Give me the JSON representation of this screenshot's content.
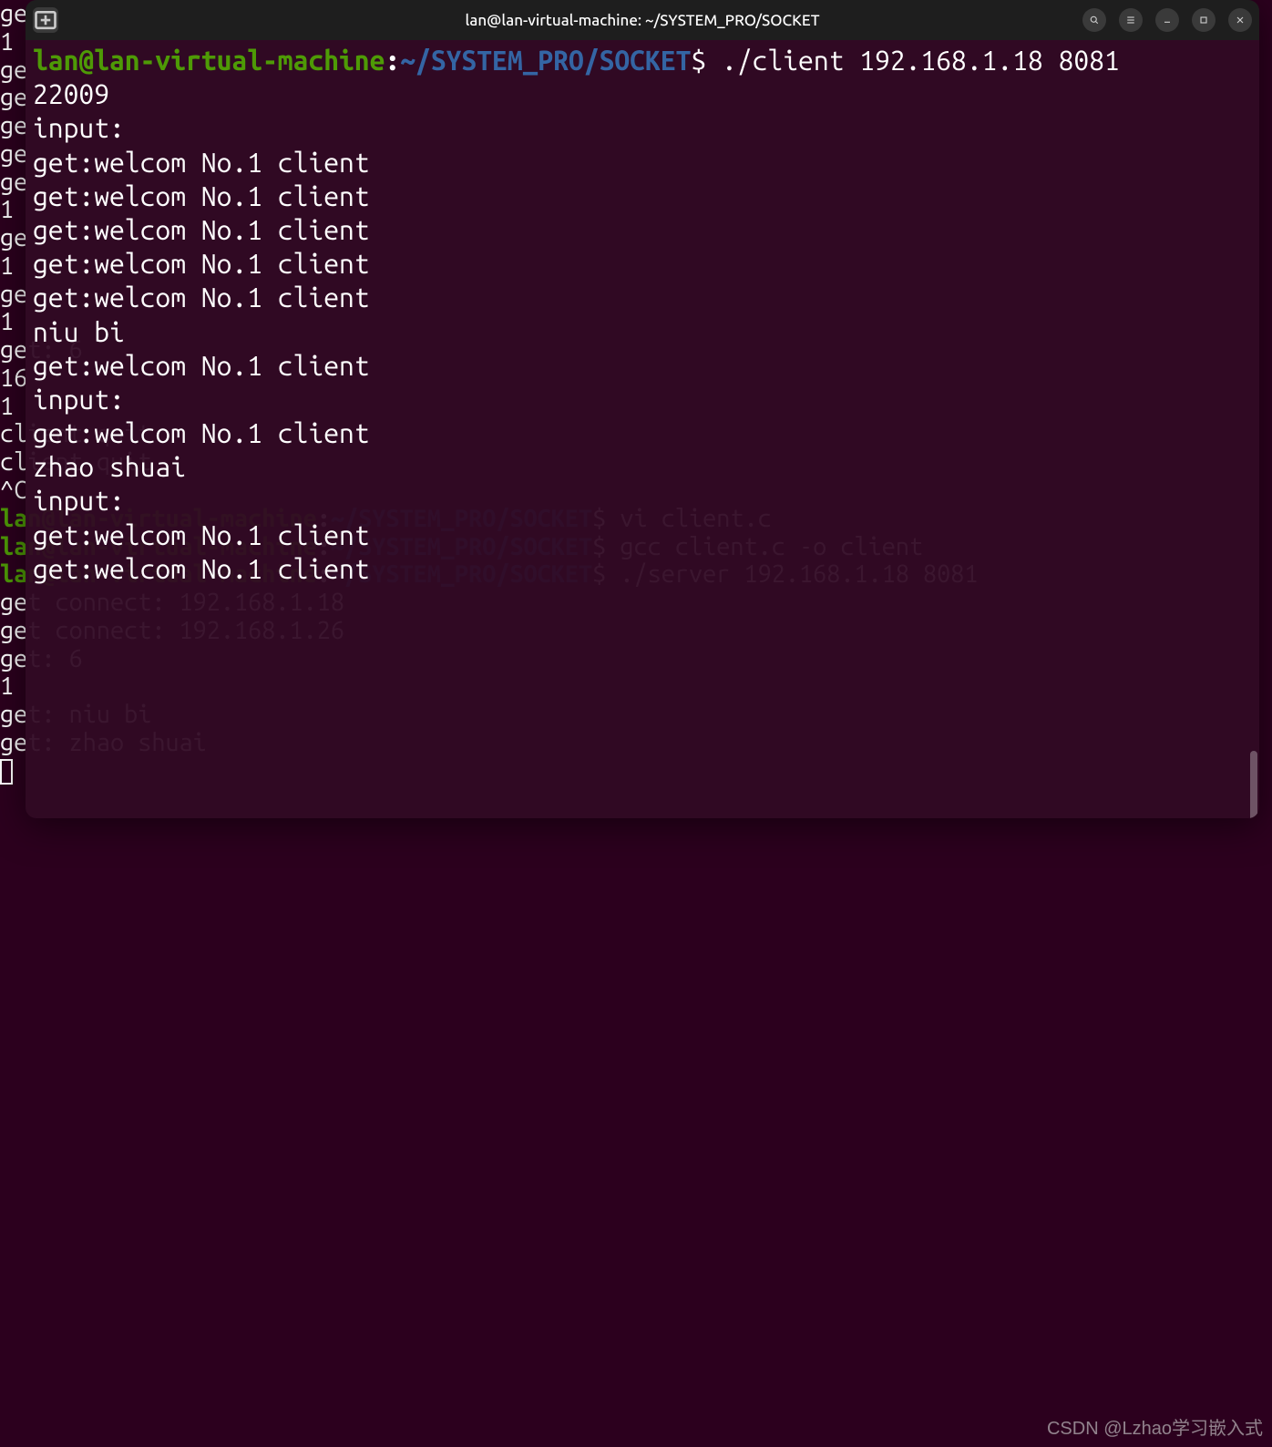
{
  "window": {
    "title": "lan@lan-virtual-machine: ~/SYSTEM_PRO/SOCKET"
  },
  "prompt": {
    "user": "lan@lan-virtual-machine",
    "path": "~/SYSTEM_PRO/SOCKET",
    "symbol": "$"
  },
  "fg_lines": {
    "cmd1": " ./client 192.168.1.18 8081",
    "l2": "22009",
    "l3": "input:",
    "l4": "get:welcom No.1 client",
    "l5": "",
    "l6": "get:welcom No.1 client",
    "l7": "",
    "l8": "get:welcom No.1 client",
    "l9": "",
    "l10": "get:welcom No.1 client",
    "l11": "",
    "l12": "get:welcom No.1 client",
    "l13": "niu bi",
    "l14": "get:welcom No.1 client",
    "l15": "",
    "l16": "input:",
    "l17": "get:welcom No.1 client",
    "l18": "zhao shuai",
    "l19": "input:",
    "l20": "get:welcom No.1 client",
    "l21": "",
    "l22": "get:welcom No.1 client"
  },
  "bg_left": {
    "b0": "ge",
    "b1": "1",
    "b2": "",
    "b3": "",
    "b4": "",
    "b5": "ge",
    "b6": "",
    "b7": "",
    "b8": "ge",
    "b9": "",
    "b10": "",
    "b11": "ge",
    "b12": "",
    "b13": "",
    "b14": "ge",
    "b15": "",
    "b16": "ge",
    "b17": "1",
    "b18": "",
    "b19": "",
    "b20": "ge",
    "b21": "1",
    "b22": "",
    "b23": "ge",
    "b24": "1"
  },
  "bg_lines": {
    "g1": "",
    "g2": "get: 6",
    "g3": "16",
    "g4": "1",
    "g5": "client quit",
    "g6": "client quit",
    "g7": "^C",
    "cmd_vi": " vi client.c",
    "cmd_gcc": " gcc client.c -o client",
    "cmd_server": " ./server 192.168.1.18 8081",
    "g11": "get connect: 192.168.1.18",
    "g12": "get connect: 192.168.1.26",
    "g13": "",
    "g14": "get: 6",
    "g15": "1",
    "g16": "",
    "g17": "get: niu bi",
    "g18": "",
    "g19": "",
    "g20": "get: zhao shuai",
    "g21": ""
  },
  "watermark": "CSDN @Lzhao学习嵌入式"
}
